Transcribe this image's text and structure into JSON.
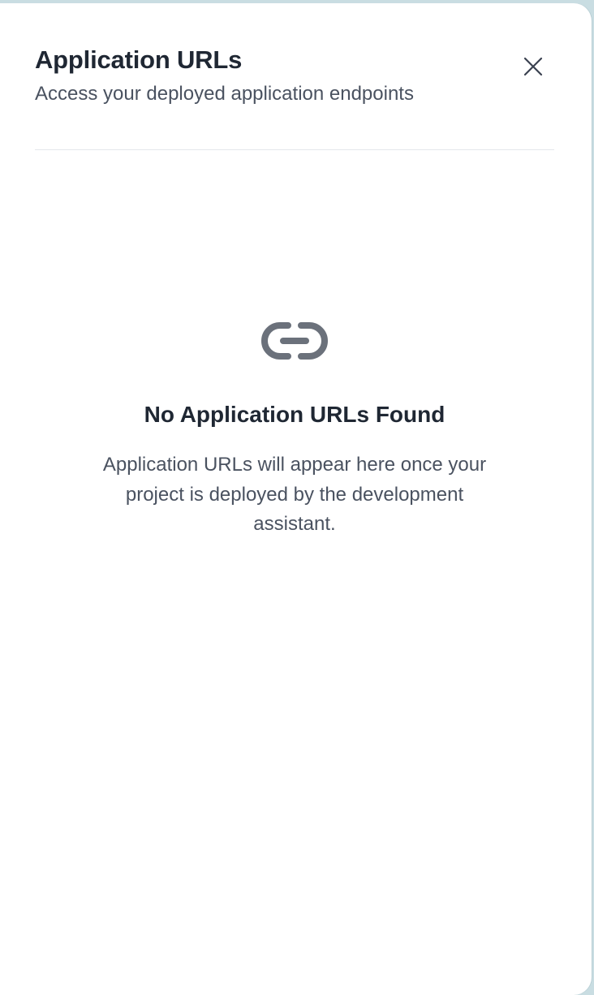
{
  "dialog": {
    "title": "Application URLs",
    "subtitle": "Access your deployed application endpoints",
    "close_icon": "close-icon"
  },
  "empty_state": {
    "icon": "link-icon",
    "title": "No Application URLs Found",
    "description": "Application URLs will appear here once your project is deployed by the development assistant."
  },
  "colors": {
    "title_text": "#1f2733",
    "body_text": "#4a5260",
    "icon": "#6b717b",
    "divider": "#e4e7eb",
    "backdrop": "#c9dde2"
  }
}
